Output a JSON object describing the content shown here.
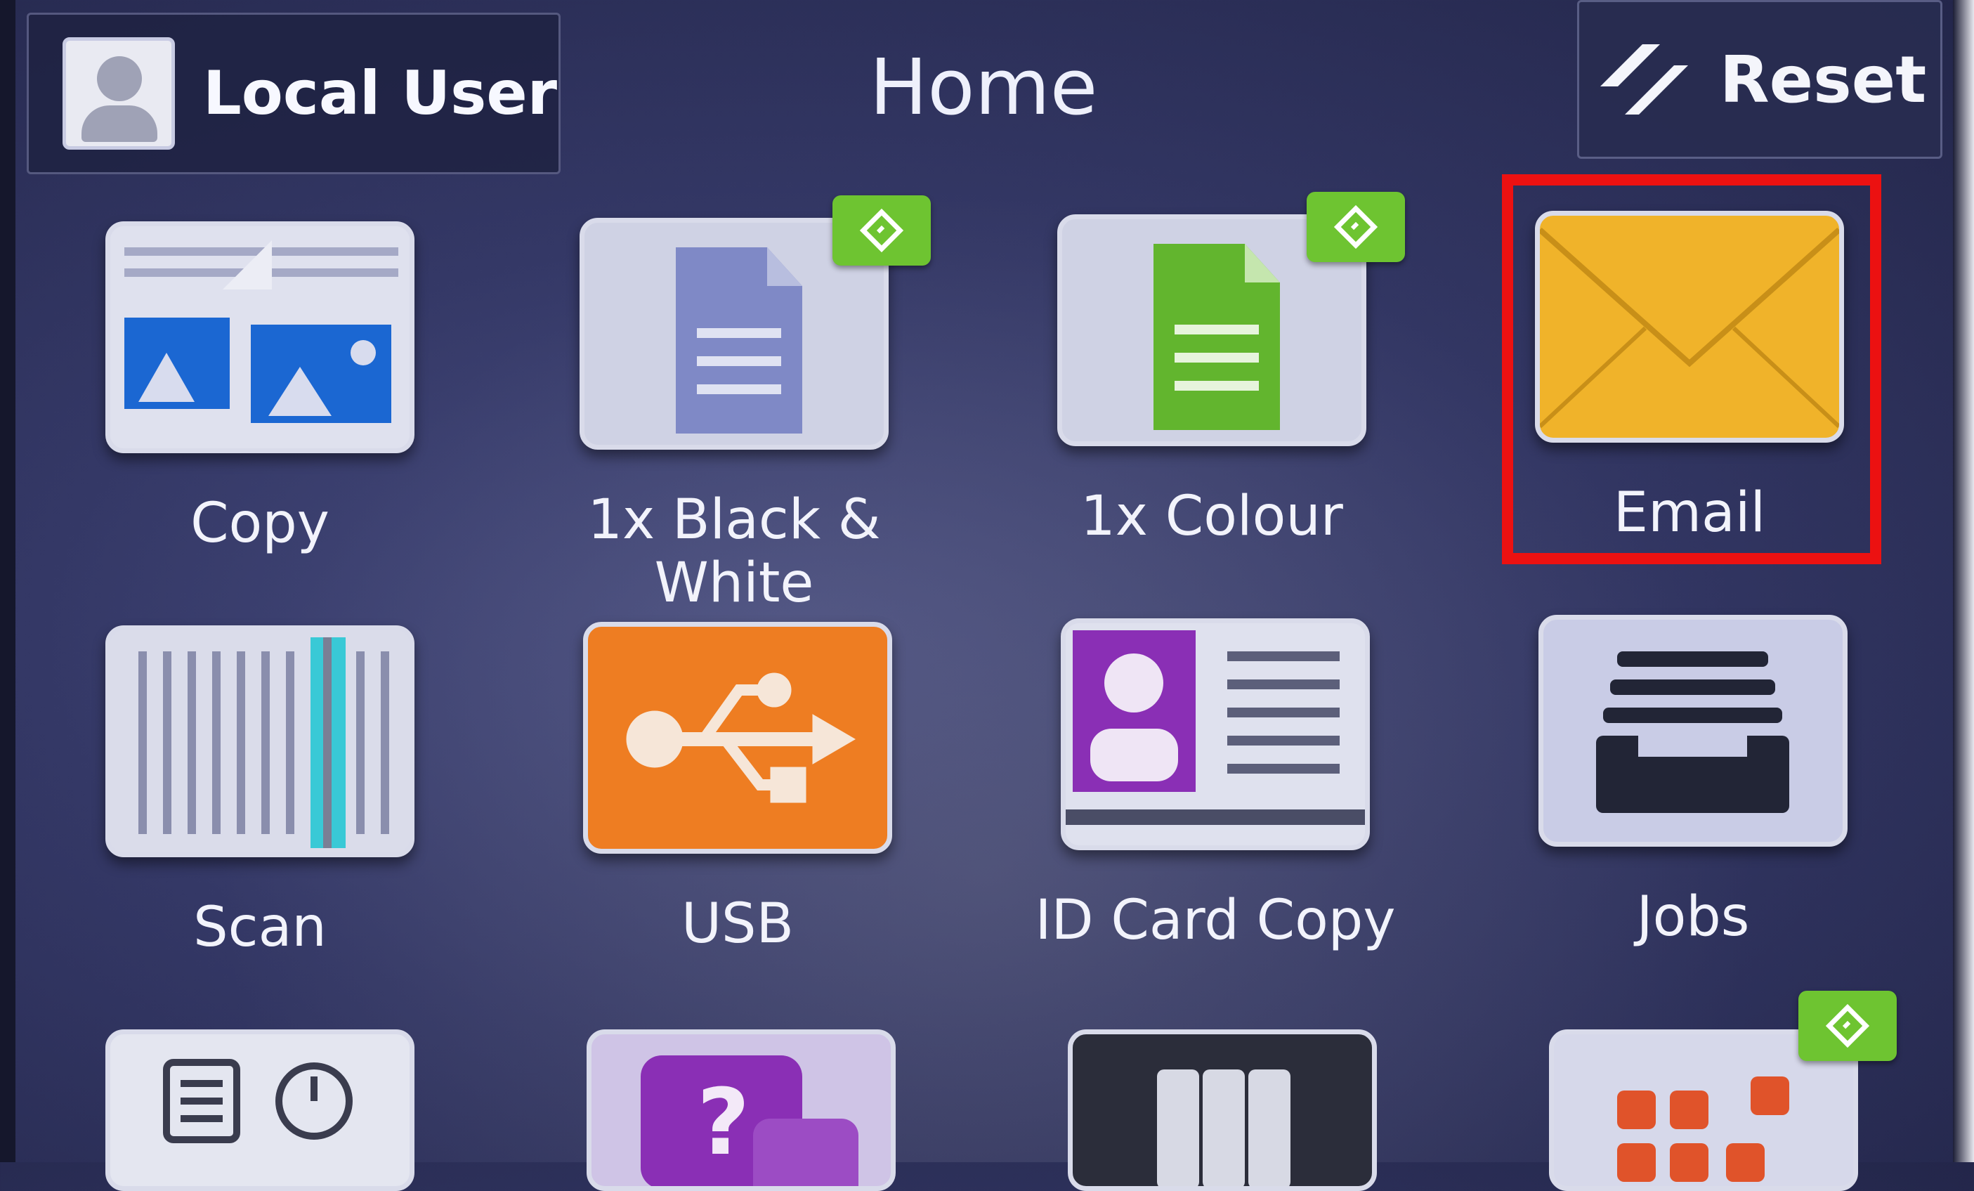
{
  "header": {
    "user_label": "Local User",
    "page_title": "Home",
    "reset_label": "Reset"
  },
  "apps": [
    {
      "label": "Copy",
      "icon": "copy-icon"
    },
    {
      "label": "1x Black & White",
      "icon": "document-icon",
      "badge": "app-badge-icon"
    },
    {
      "label": "1x Colour",
      "icon": "document-icon",
      "badge": "app-badge-icon"
    },
    {
      "label": "Email",
      "icon": "envelope-icon",
      "highlighted": true
    },
    {
      "label": "Scan",
      "icon": "scanner-icon"
    },
    {
      "label": "USB",
      "icon": "usb-icon"
    },
    {
      "label": "ID Card Copy",
      "icon": "id-card-icon"
    },
    {
      "label": "Jobs",
      "icon": "jobs-tray-icon"
    }
  ],
  "colors": {
    "highlight": "#ec1111",
    "badge": "#6ec431",
    "email_tile": "#f0b32a",
    "usb_tile": "#ee7d22",
    "id_card_purple": "#8a2fb5"
  }
}
